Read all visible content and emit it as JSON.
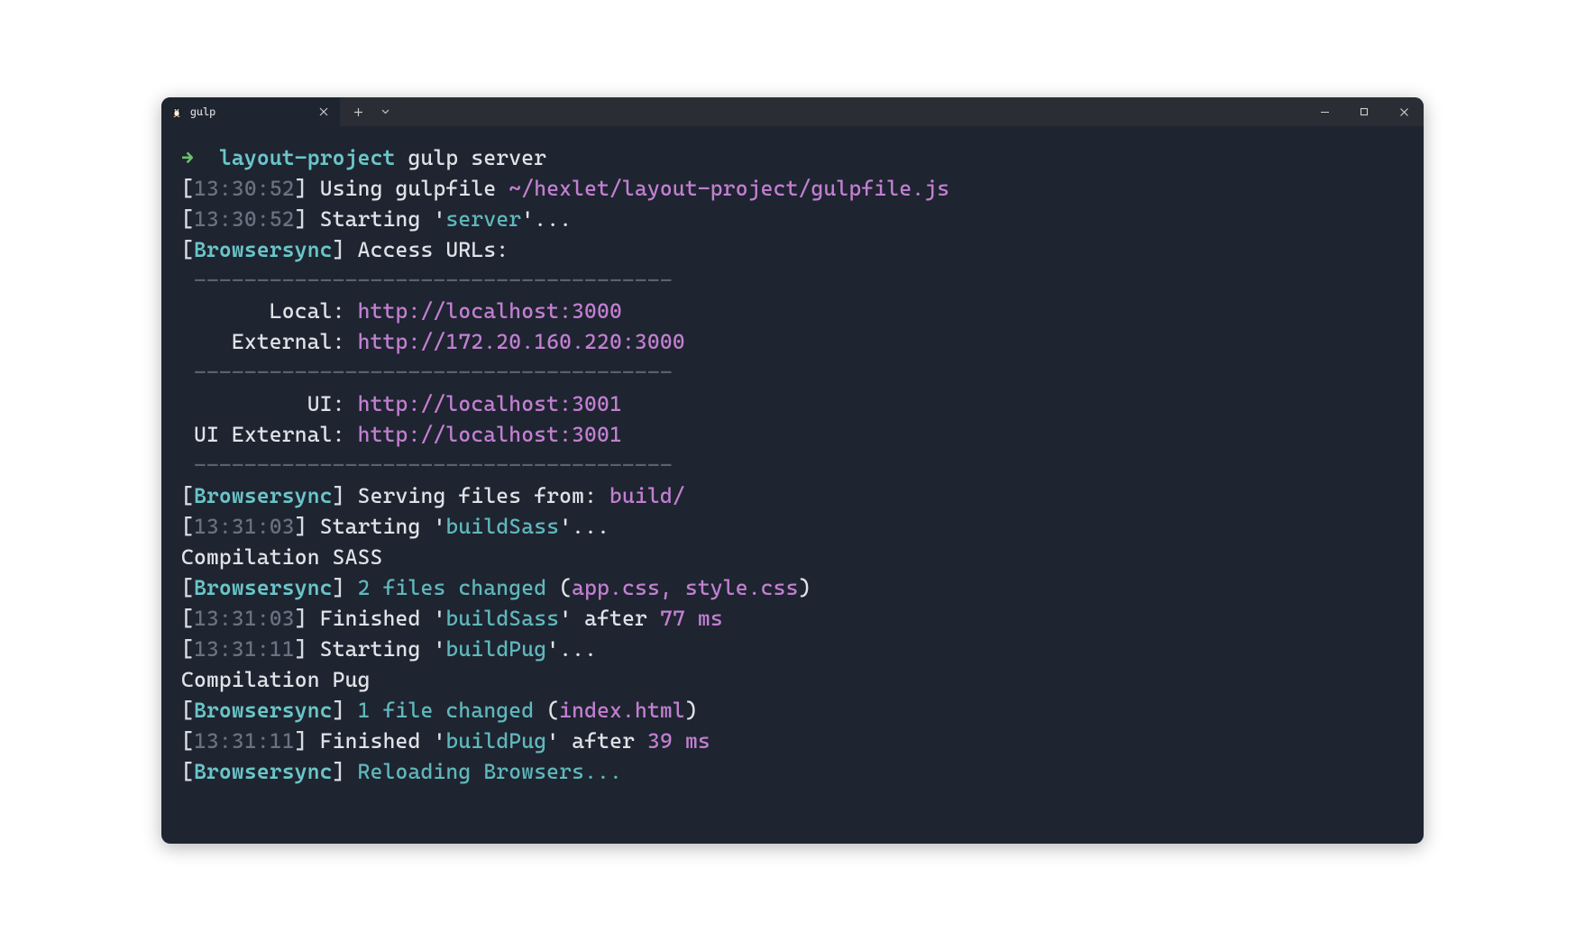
{
  "tab": {
    "title": "gulp"
  },
  "prompt": {
    "arrow": "→",
    "dir": "layout-project",
    "cmd": "gulp server"
  },
  "lines": {
    "ts1": "13:30:52",
    "using": "Using gulpfile",
    "gulpfile_path": "~/hexlet/layout-project/gulpfile.js",
    "ts2": "13:30:52",
    "starting": "Starting",
    "server_task": "server",
    "bs": "Browsersync",
    "access_urls": "Access URLs:",
    "divider": " --------------------------------------",
    "local_lbl": "       Local:",
    "local_url": "http://localhost:3000",
    "external_lbl": "    External:",
    "external_url": "http://172.20.160.220:3000",
    "ui_lbl": "          UI:",
    "ui_url": "http://localhost:3001",
    "ui_ext_lbl": " UI External:",
    "ui_ext_url": "http://localhost:3001",
    "serving": "Serving files from:",
    "serving_dir": "build/",
    "ts3": "13:31:03",
    "buildSass": "buildSass",
    "comp_sass": "Compilation SASS",
    "changed2": "2 files changed",
    "changed2_files": "app.css, style.css",
    "ts4": "13:31:03",
    "finished": "Finished",
    "after": "after",
    "sass_ms": "77 ms",
    "ts5": "13:31:11",
    "buildPug": "buildPug",
    "comp_pug": "Compilation Pug",
    "changed1": "1 file changed",
    "changed1_files": "index.html",
    "ts6": "13:31:11",
    "pug_ms": "39 ms",
    "reloading": "Reloading Browsers..."
  }
}
